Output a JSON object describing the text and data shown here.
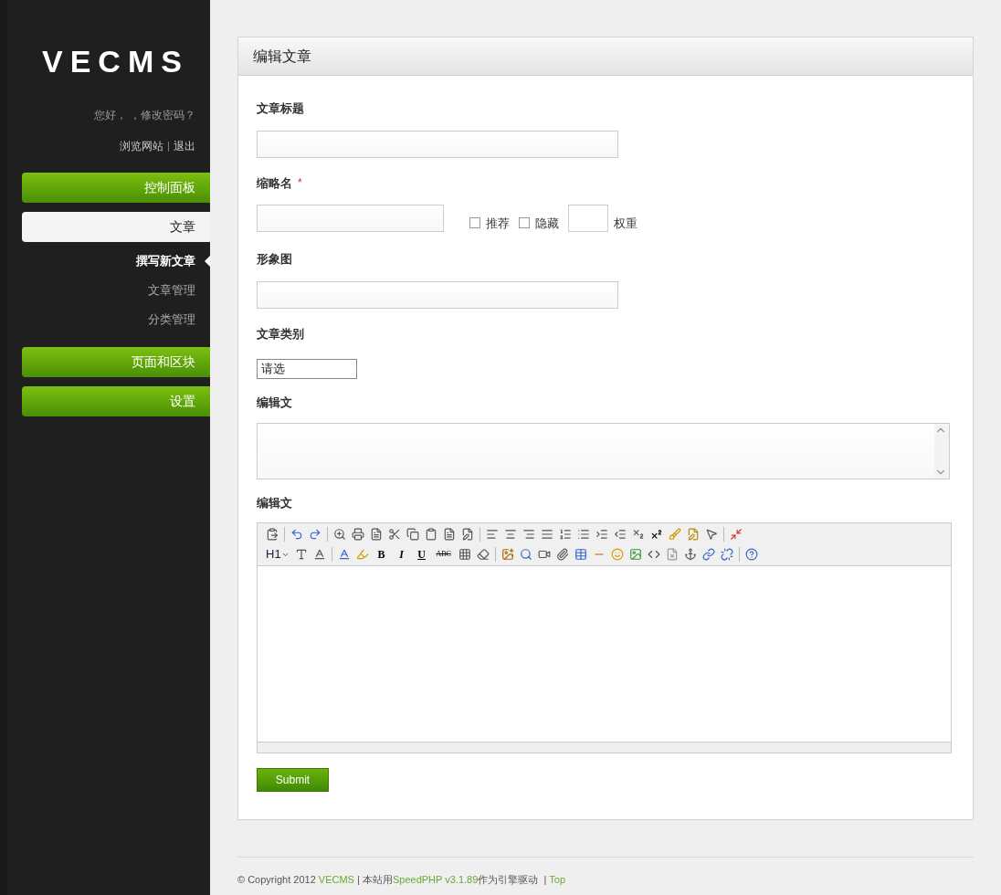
{
  "sidebar": {
    "logo": "VECMS",
    "greeting": "您好， ，修改密码？",
    "links": [
      "浏览网站",
      "退出"
    ],
    "nav": [
      {
        "label": "控制面板",
        "selected": false
      },
      {
        "label": "文章",
        "selected": true,
        "children": [
          {
            "label": "撰写新文章",
            "selected": true
          },
          {
            "label": "文章管理",
            "selected": false
          },
          {
            "label": "分类管理",
            "selected": false
          }
        ]
      },
      {
        "label": "页面和区块",
        "selected": false
      },
      {
        "label": "设置",
        "selected": false
      }
    ]
  },
  "panel": {
    "title": "编辑文章",
    "title_label": "文章标题",
    "slug_label": "缩略名",
    "required_mark": "*",
    "flags": [
      {
        "label": "推荐",
        "checked": false
      },
      {
        "label": "隐藏",
        "checked": false
      }
    ],
    "weight_label": "权重",
    "image_label": "形象图",
    "category_label": "文章类别",
    "category_value": "请选",
    "summary_label": "编辑文",
    "content_label": "编辑文",
    "format_buttons": [
      "H1",
      "B",
      "I",
      "U",
      "ABC"
    ],
    "submit": "Submit"
  },
  "footer": {
    "prefix": "© Copyright 2012 ",
    "site": "VECMS",
    "middle": " | 本站用",
    "engine": "SpeedPHP v3.1.89",
    "suffix": "作为引擎驱动  | ",
    "top": "Top"
  }
}
